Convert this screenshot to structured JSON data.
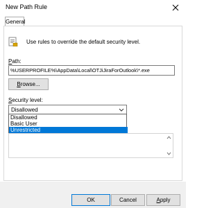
{
  "window": {
    "title": "New Path Rule"
  },
  "tabs": [
    {
      "label": "General"
    }
  ],
  "main": {
    "description": "Use rules to override the default security level.",
    "path_label_u": "P",
    "path_label_rest": "ath:",
    "path_value": "%USERPROFILE%\\AppData\\Local\\OTJiJiraForOutlook\\*.exe",
    "browse_u": "B",
    "browse_rest": "rowse...",
    "security_label_u": "S",
    "security_label_rest": "ecurity level:",
    "security_selected": "Disallowed",
    "security_options": [
      "Disallowed",
      "Basic User",
      "Unrestricted"
    ]
  },
  "footer": {
    "ok": "OK",
    "cancel": "Cancel",
    "apply_u": "A",
    "apply_rest": "pply"
  }
}
